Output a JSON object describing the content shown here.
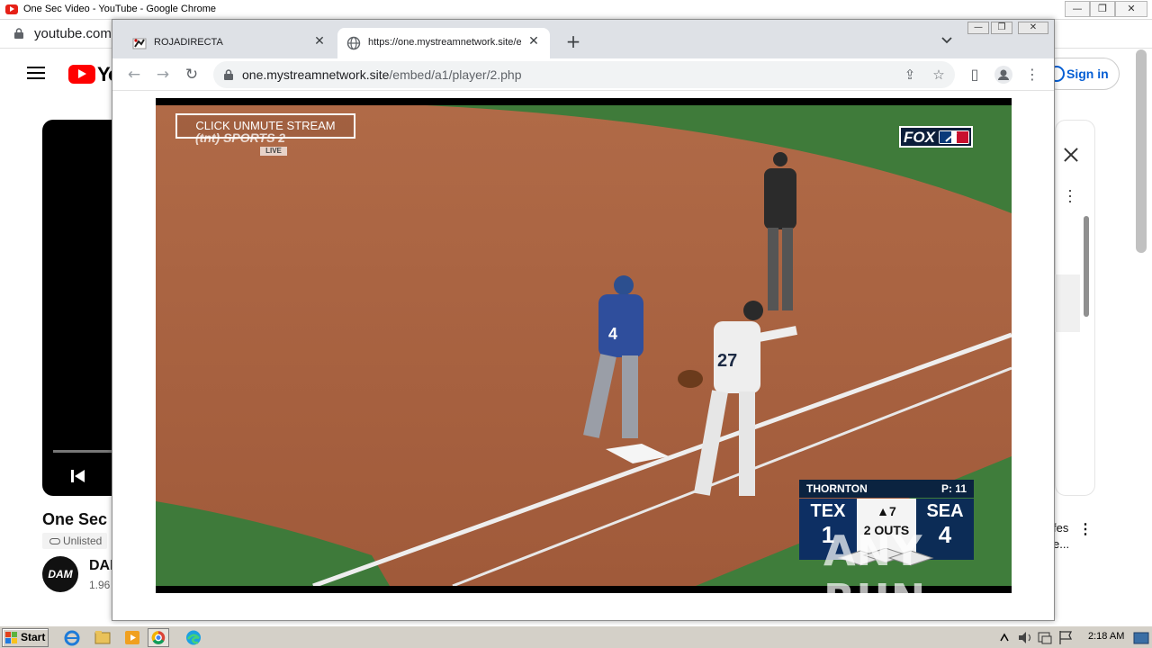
{
  "background_window": {
    "title": "One Sec Video - YouTube - Google Chrome",
    "url": "youtube.com",
    "controls": {
      "minimize": "—",
      "restore": "❐",
      "close": "✕"
    },
    "header": {
      "logo_text": "Yo",
      "sign_in": "Sign in"
    },
    "video": {
      "title": "One Sec",
      "visibility": "Unlisted",
      "channel_avatar": "DAM",
      "channel": "DAI",
      "subscribers": "1.96"
    },
    "side_panel": {
      "recommendation_text": "fes\ne..."
    }
  },
  "popup_window": {
    "tabs": [
      {
        "title": "ROJADIRECTA",
        "active": false
      },
      {
        "title": "https://one.mystreamnetwork.site/e",
        "active": true
      }
    ],
    "new_tab": "+",
    "tab_search": "⌄",
    "controls": {
      "minimize": "—",
      "restore": "❐",
      "close": "✕"
    },
    "omnibox": {
      "url_host": "one.mystreamnetwork.site",
      "url_path": "/embed/a1/player/2.php"
    },
    "nav": {
      "back": "←",
      "forward": "→",
      "reload": "↻"
    },
    "toolbar_icons": {
      "share": "⇪",
      "bookmark": "☆",
      "side_panel": "▯",
      "menu": "⋮"
    }
  },
  "player": {
    "unmute_label": "CLICK UNMUTE STREAM",
    "network_logo": "(tnt) SPORTS 2",
    "network_live": "LIVE",
    "broadcaster_logo": "FOX",
    "scorebug": {
      "pitcher": "THORNTON",
      "pitch_count": "P: 11",
      "away_team": "TEX",
      "away_score": "1",
      "inning": "▲7",
      "outs": "2 OUTS",
      "home_team": "SEA",
      "home_score": "4"
    },
    "players": {
      "runner_number": "4",
      "fielder_number": "27"
    }
  },
  "watermark": "ANY RUN",
  "taskbar": {
    "start_label": "Start",
    "clock": "2:18 AM",
    "apps": [
      "ie-icon",
      "explorer-icon",
      "media-player-icon",
      "chrome-icon",
      "edge-icon"
    ]
  },
  "colors": {
    "infield_dirt": "#a45f3e",
    "grass": "#3e7a3a",
    "scorebug_navy": "#0b2340",
    "youtube_red": "#ff0000"
  }
}
